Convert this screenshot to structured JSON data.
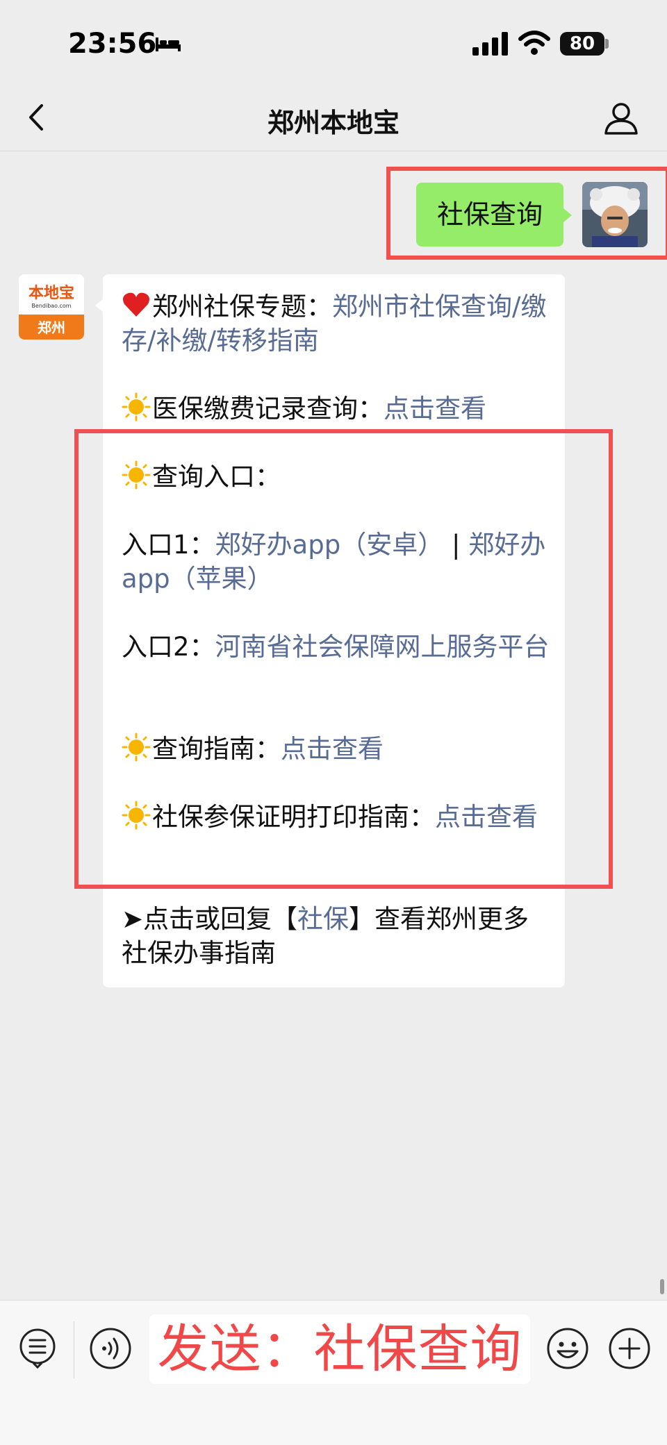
{
  "status": {
    "time": "23:56",
    "battery": "80"
  },
  "nav": {
    "title": "郑州本地宝"
  },
  "outgoing": {
    "text": "社保查询"
  },
  "bot_avatar": {
    "brand": "本地宝",
    "site": "Bendibao.com",
    "city": "郑州"
  },
  "reply": {
    "p1_label": "郑州社保专题：",
    "p1_link": "郑州市社保查询/缴存/补缴/转移指南",
    "p2_label": "医保缴费记录查询：",
    "p2_link": "点击查看",
    "p3_label": "查询入口：",
    "p4_label": "入口1：",
    "p4_link_a": "郑好办app（安卓）",
    "p4_sep": " | ",
    "p4_link_b": "郑好办app（苹果）",
    "p5_label": "入口2：",
    "p5_link": "河南省社会保障网上服务平台",
    "p6_label": "查询指南：",
    "p6_link": "点击查看",
    "p7_label": "社保参保证明打印指南：",
    "p7_link": "点击查看",
    "p8_prefix": "➤点击或回复【",
    "p8_link": "社保",
    "p8_suffix": "】查看郑州更多社保办事指南"
  },
  "input": {
    "text": "发送：社保查询"
  },
  "colors": {
    "background": "#ededed",
    "bubble_out": "#95ec69",
    "link": "#576b95",
    "highlight": "#f05050"
  }
}
